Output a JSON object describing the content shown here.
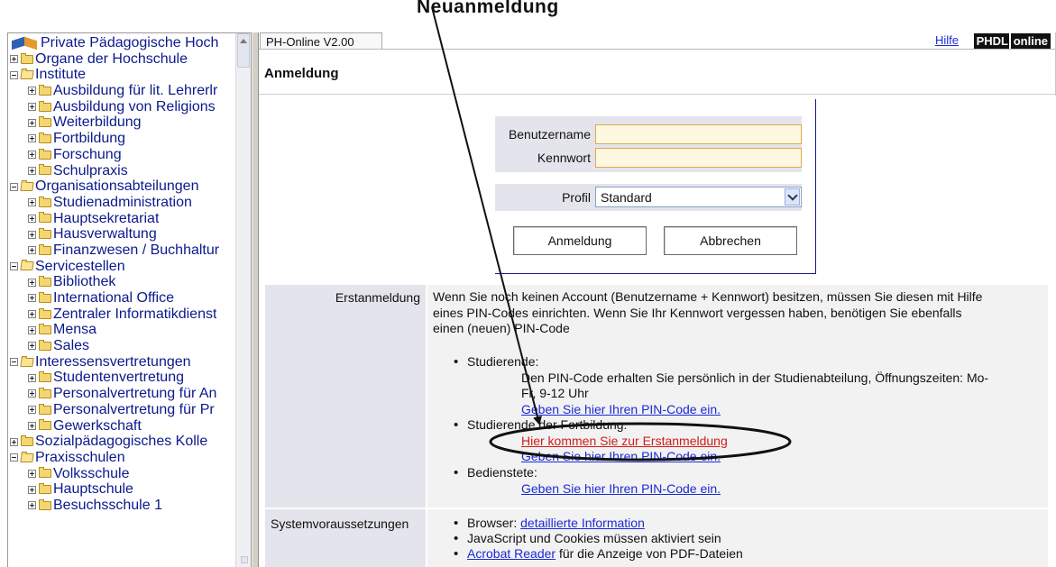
{
  "caption": "Neuanmeldung",
  "tree": {
    "root_label": "Private Pädagogische Hoch",
    "items": [
      {
        "label": "Organe der Hochschule",
        "level": 0,
        "expanded": false
      },
      {
        "label": "Institute",
        "level": 0,
        "expanded": true
      },
      {
        "label": "Ausbildung für lit. Lehrerlr",
        "level": 1,
        "expanded": false
      },
      {
        "label": "Ausbildung von Religions",
        "level": 1,
        "expanded": false
      },
      {
        "label": "Weiterbildung",
        "level": 1,
        "expanded": false
      },
      {
        "label": "Fortbildung",
        "level": 1,
        "expanded": false
      },
      {
        "label": "Forschung",
        "level": 1,
        "expanded": false
      },
      {
        "label": "Schulpraxis",
        "level": 1,
        "expanded": false
      },
      {
        "label": "Organisationsabteilungen",
        "level": 0,
        "expanded": true
      },
      {
        "label": "Studienadministration",
        "level": 1,
        "expanded": false
      },
      {
        "label": "Hauptsekretariat",
        "level": 1,
        "expanded": false
      },
      {
        "label": "Hausverwaltung",
        "level": 1,
        "expanded": false
      },
      {
        "label": "Finanzwesen / Buchhaltur",
        "level": 1,
        "expanded": false
      },
      {
        "label": "Servicestellen",
        "level": 0,
        "expanded": true
      },
      {
        "label": "Bibliothek",
        "level": 1,
        "expanded": false
      },
      {
        "label": "International Office",
        "level": 1,
        "expanded": false
      },
      {
        "label": "Zentraler Informatikdienst",
        "level": 1,
        "expanded": false
      },
      {
        "label": "Mensa",
        "level": 1,
        "expanded": false
      },
      {
        "label": "Sales",
        "level": 1,
        "expanded": false
      },
      {
        "label": "Interessensvertretungen",
        "level": 0,
        "expanded": true
      },
      {
        "label": "Studentenvertretung",
        "level": 1,
        "expanded": false
      },
      {
        "label": "Personalvertretung für An",
        "level": 1,
        "expanded": false
      },
      {
        "label": "Personalvertretung für Pr",
        "level": 1,
        "expanded": false
      },
      {
        "label": "Gewerkschaft",
        "level": 1,
        "expanded": false
      },
      {
        "label": "Sozialpädagogisches Kolle",
        "level": 0,
        "expanded": false
      },
      {
        "label": "Praxisschulen",
        "level": 0,
        "expanded": true
      },
      {
        "label": "Volksschule",
        "level": 1,
        "expanded": false
      },
      {
        "label": "Hauptschule",
        "level": 1,
        "expanded": false
      },
      {
        "label": "Besuchsschule 1",
        "level": 1,
        "expanded": false
      }
    ]
  },
  "header": {
    "app_tab": "PH-Online V2.00",
    "help_link": "Hilfe",
    "logo_left": "PHDL",
    "logo_right": "online",
    "page_title": "Anmeldung"
  },
  "login": {
    "username_label": "Benutzername",
    "username_value": "",
    "password_label": "Kennwort",
    "password_value": "",
    "profile_label": "Profil",
    "profile_value": "Standard",
    "login_button": "Anmeldung",
    "cancel_button": "Abbrechen"
  },
  "info": {
    "first_login_label": "Erstanmeldung",
    "first_login_text_1": "Wenn Sie noch keinen Account (Benutzername + Kennwort) besitzen, müssen Sie diesen mit Hilfe",
    "first_login_text_2": "eines PIN-Codes einrichten. Wenn Sie Ihr Kennwort vergessen haben, benötigen Sie ebenfalls",
    "first_login_text_3": "einen (neuen) PIN-Code",
    "students_label": "Studierende:",
    "students_text_1": "Den PIN-Code erhalten Sie persönlich in der Studienabteilung, Öffnungszeiten: Mo-",
    "students_text_2": "Fr, 9-12 Uhr",
    "students_pin_link": "Geben Sie hier Ihren PIN-Code ein.",
    "cont_students_label": "Studierende der Fortbildung:",
    "first_login_link": "Hier kommen Sie zur Erstanmeldung",
    "cont_students_pin_link": "Geben Sie hier Ihren PIN-Code ein.",
    "staff_label": "Bedienstete:",
    "staff_pin_link": "Geben Sie hier Ihren PIN-Code ein.",
    "requirements_label": "Systemvoraussetzungen",
    "req_browser_prefix": "Browser: ",
    "req_browser_link": "detaillierte Information",
    "req_js": "JavaScript und Cookies müssen aktiviert sein",
    "req_acrobat_link": "Acrobat Reader",
    "req_acrobat_suffix": " für die Anzeige von PDF-Dateien"
  },
  "colors": {
    "link": "#1a2bd6",
    "highlight_link": "#d21a1a",
    "label_bg": "#e4e4ec",
    "content_bg": "#f2f2f2",
    "input_border": "#e0a84a"
  }
}
